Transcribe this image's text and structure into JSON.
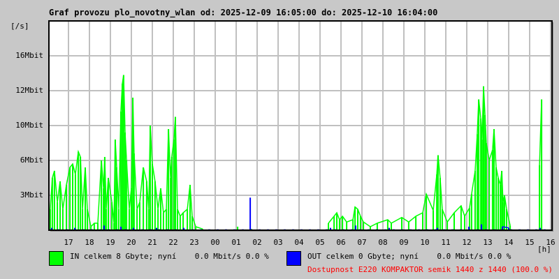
{
  "title": "Graf provozu plo_novotny_wlan od: 2025-12-09 16:05:00 do: 2025-12-10 16:04:00",
  "legend": {
    "in_text": "IN celkem 8 Gbyte; nyní    0.0 Mbit/s 0.0 %",
    "out_text": "OUT celkem 0 Gbyte; nyní    0.0 Mbit/s 0.0 %",
    "availability": "Dostupnost E220 KOMPAKTOR semik 1440 z 1440 (100.0 %)"
  },
  "colors": {
    "in": "#00ff00",
    "out": "#0000ff",
    "availability": "#ff0000",
    "grid": "#c0c0c0"
  },
  "chart_data": {
    "type": "line",
    "title": "Graf provozu plo_novotny_wlan od: 2025-12-09 16:05:00 do: 2025-12-10 16:04:00",
    "ylabel": "[/s]",
    "xlabel": "[h]",
    "y_ticks": [
      {
        "value": 3,
        "label": "3Mbit"
      },
      {
        "value": 6,
        "label": "6Mbit"
      },
      {
        "value": 10,
        "label": "10Mbit"
      },
      {
        "value": 12,
        "label": "12Mbit"
      },
      {
        "value": 16,
        "label": "16Mbit"
      }
    ],
    "x_ticks": [
      "17",
      "18",
      "19",
      "20",
      "21",
      "22",
      "23",
      "00",
      "01",
      "02",
      "03",
      "04",
      "05",
      "06",
      "07",
      "08",
      "09",
      "10",
      "11",
      "12",
      "13",
      "14",
      "15",
      "16"
    ],
    "x_range_hours": [
      16.07,
      40.07
    ],
    "grid": true,
    "series": [
      {
        "name": "IN",
        "color": "#00ff00",
        "points": [
          [
            16.13,
            1.8
          ],
          [
            16.23,
            4.5
          ],
          [
            16.33,
            5.1
          ],
          [
            16.47,
            2.4
          ],
          [
            16.6,
            4.2
          ],
          [
            16.73,
            1.8
          ],
          [
            16.9,
            3.9
          ],
          [
            17.07,
            5.4
          ],
          [
            17.2,
            5.7
          ],
          [
            17.33,
            4.8
          ],
          [
            17.47,
            7.0
          ],
          [
            17.57,
            6.4
          ],
          [
            17.67,
            1.8
          ],
          [
            17.8,
            5.4
          ],
          [
            17.9,
            1.8
          ],
          [
            18.07,
            0.3
          ],
          [
            18.23,
            0.6
          ],
          [
            18.4,
            0.6
          ],
          [
            18.57,
            6.0
          ],
          [
            18.67,
            3.6
          ],
          [
            18.73,
            6.4
          ],
          [
            18.8,
            1.8
          ],
          [
            18.9,
            4.5
          ],
          [
            19.07,
            2.4
          ],
          [
            19.17,
            0.6
          ],
          [
            19.23,
            8.4
          ],
          [
            19.3,
            5.4
          ],
          [
            19.4,
            1.8
          ],
          [
            19.5,
            10.8
          ],
          [
            19.57,
            12.8
          ],
          [
            19.63,
            13.8
          ],
          [
            19.7,
            9.2
          ],
          [
            19.77,
            6.0
          ],
          [
            19.9,
            1.8
          ],
          [
            20.0,
            3.6
          ],
          [
            20.07,
            11.6
          ],
          [
            20.13,
            6.8
          ],
          [
            20.27,
            1.8
          ],
          [
            20.4,
            2.4
          ],
          [
            20.57,
            5.4
          ],
          [
            20.73,
            4.2
          ],
          [
            20.83,
            1.8
          ],
          [
            20.9,
            10.0
          ],
          [
            21.0,
            5.7
          ],
          [
            21.13,
            4.2
          ],
          [
            21.27,
            1.8
          ],
          [
            21.4,
            3.6
          ],
          [
            21.53,
            1.5
          ],
          [
            21.67,
            1.8
          ],
          [
            21.77,
            9.6
          ],
          [
            21.87,
            4.5
          ],
          [
            21.93,
            6.4
          ],
          [
            22.03,
            8.4
          ],
          [
            22.1,
            10.5
          ],
          [
            22.2,
            1.8
          ],
          [
            22.33,
            1.2
          ],
          [
            22.47,
            1.5
          ],
          [
            22.67,
            1.8
          ],
          [
            22.8,
            3.9
          ],
          [
            22.9,
            1.2
          ],
          [
            23.07,
            0.3
          ],
          [
            23.4,
            0.1
          ],
          [
            25.07,
            0.3
          ],
          [
            25.73,
            0.1
          ],
          [
            29.4,
            0.6
          ],
          [
            29.67,
            1.2
          ],
          [
            29.8,
            1.5
          ],
          [
            29.93,
            0.9
          ],
          [
            30.07,
            1.2
          ],
          [
            30.27,
            0.7
          ],
          [
            30.57,
            0.9
          ],
          [
            30.67,
            2.0
          ],
          [
            30.8,
            1.8
          ],
          [
            30.93,
            1.2
          ],
          [
            31.07,
            0.7
          ],
          [
            31.4,
            0.3
          ],
          [
            31.73,
            0.6
          ],
          [
            32.23,
            0.9
          ],
          [
            32.4,
            0.6
          ],
          [
            32.9,
            1.1
          ],
          [
            33.23,
            0.7
          ],
          [
            33.57,
            1.2
          ],
          [
            33.9,
            1.5
          ],
          [
            34.07,
            3.1
          ],
          [
            34.4,
            1.7
          ],
          [
            34.57,
            4.8
          ],
          [
            34.63,
            6.6
          ],
          [
            34.73,
            4.5
          ],
          [
            34.83,
            1.8
          ],
          [
            35.07,
            0.7
          ],
          [
            35.4,
            1.5
          ],
          [
            35.73,
            2.1
          ],
          [
            35.9,
            1.2
          ],
          [
            36.13,
            1.9
          ],
          [
            36.23,
            3.1
          ],
          [
            36.4,
            5.1
          ],
          [
            36.5,
            9.0
          ],
          [
            36.57,
            11.5
          ],
          [
            36.67,
            10.4
          ],
          [
            36.73,
            8.4
          ],
          [
            36.8,
            12.5
          ],
          [
            36.87,
            10.6
          ],
          [
            36.93,
            8.0
          ],
          [
            37.07,
            6.0
          ],
          [
            37.23,
            7.2
          ],
          [
            37.3,
            9.6
          ],
          [
            37.4,
            5.4
          ],
          [
            37.5,
            4.5
          ],
          [
            37.6,
            3.9
          ],
          [
            37.67,
            5.1
          ],
          [
            37.73,
            2.4
          ],
          [
            37.8,
            3.0
          ],
          [
            37.9,
            1.8
          ],
          [
            38.07,
            0.4
          ],
          [
            39.47,
            5.6
          ],
          [
            39.57,
            11.5
          ]
        ]
      },
      {
        "name": "OUT",
        "color": "#0000ff",
        "points": [
          [
            16.2,
            0.2
          ],
          [
            17.3,
            0.2
          ],
          [
            18.7,
            0.4
          ],
          [
            19.5,
            0.3
          ],
          [
            20.1,
            0.2
          ],
          [
            21.2,
            0.2
          ],
          [
            22.5,
            0.2
          ],
          [
            25.67,
            2.8
          ],
          [
            29.5,
            0.2
          ],
          [
            30.7,
            0.4
          ],
          [
            32.3,
            0.2
          ],
          [
            34.6,
            0.2
          ],
          [
            36.1,
            0.3
          ],
          [
            36.7,
            0.5
          ],
          [
            37.7,
            0.3
          ],
          [
            38.0,
            0.2
          ],
          [
            39.5,
            0.2
          ]
        ]
      }
    ]
  }
}
